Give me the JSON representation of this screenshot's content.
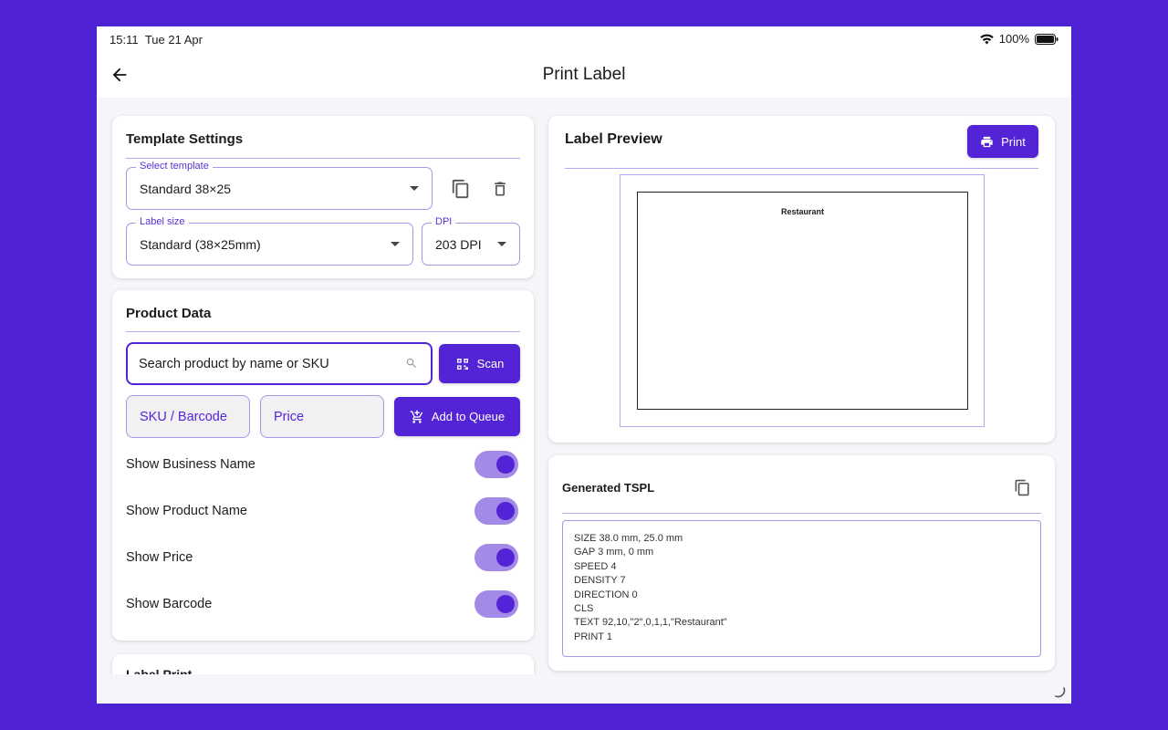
{
  "status_bar": {
    "time": "15:11",
    "date": "Tue 21 Apr",
    "battery": "100%"
  },
  "app_bar": {
    "title": "Print Label"
  },
  "template_settings": {
    "title": "Template Settings",
    "select_template": {
      "label": "Select template",
      "value": "Standard 38×25"
    },
    "label_size": {
      "label": "Label size",
      "value": "Standard (38×25mm)"
    },
    "dpi": {
      "label": "DPI",
      "value": "203 DPI"
    }
  },
  "product_data": {
    "title": "Product Data",
    "search_placeholder": "Search product by name or SKU",
    "scan_label": "Scan",
    "sku_placeholder": "SKU / Barcode",
    "price_placeholder": "Price",
    "add_to_queue_label": "Add to Queue",
    "toggles": [
      {
        "label": "Show Business Name",
        "on": true
      },
      {
        "label": "Show Product Name",
        "on": true
      },
      {
        "label": "Show Price",
        "on": true
      },
      {
        "label": "Show Barcode",
        "on": true
      }
    ]
  },
  "next_card": {
    "title": "Label Print"
  },
  "label_preview": {
    "title": "Label Preview",
    "print_label": "Print",
    "preview_text": "Restaurant"
  },
  "generated_tspl": {
    "title": "Generated TSPL",
    "lines": [
      "SIZE 38.0 mm, 25.0 mm",
      "GAP 3 mm, 0 mm",
      "SPEED 4",
      "DENSITY 7",
      "DIRECTION 0",
      "CLS",
      "TEXT 92,10,\"2\",0,1,1,\"Restaurant\"",
      "PRINT 1"
    ]
  },
  "colors": {
    "background": "#4f22d3",
    "accent": "#5324d6",
    "switch_track": "#a38ae6"
  }
}
